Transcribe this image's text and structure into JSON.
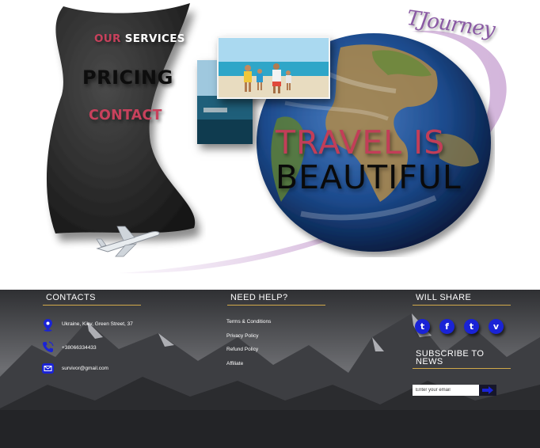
{
  "nav": {
    "services_accent": "OUR",
    "services_rest": " SERVICES",
    "pricing": "PRICING",
    "contact": "CONTACT"
  },
  "logo": "TJourney",
  "hero": {
    "headline_line1": "TRAVEL IS",
    "headline_line2": "BEAUTIFUL"
  },
  "footer": {
    "contacts": {
      "title": "CONTACTS",
      "address": "Ukraine, Kiev, Green Street, 37",
      "phone": "+38066334433",
      "email": "survivor@gmail.com"
    },
    "help": {
      "title": "NEED HELP?",
      "links": [
        "Terms & Conditions",
        "Privacy Policy",
        "Refund Policy",
        "Affiliate"
      ]
    },
    "share": {
      "title": "WILL SHARE",
      "networks": [
        {
          "name": "twitter-icon",
          "glyph": "t"
        },
        {
          "name": "facebook-icon",
          "glyph": "f"
        },
        {
          "name": "tumblr-icon",
          "glyph": "t"
        },
        {
          "name": "vimeo-icon",
          "glyph": "v"
        }
      ]
    },
    "subscribe": {
      "title": "SUBSCRIBE TO NEWS",
      "placeholder": "Enter your email"
    }
  },
  "colors": {
    "accent_pink": "#c8415c",
    "social_blue": "#1a23d6",
    "gold_rule": "#d1a94a",
    "logo_purple": "#8a5aa4"
  }
}
